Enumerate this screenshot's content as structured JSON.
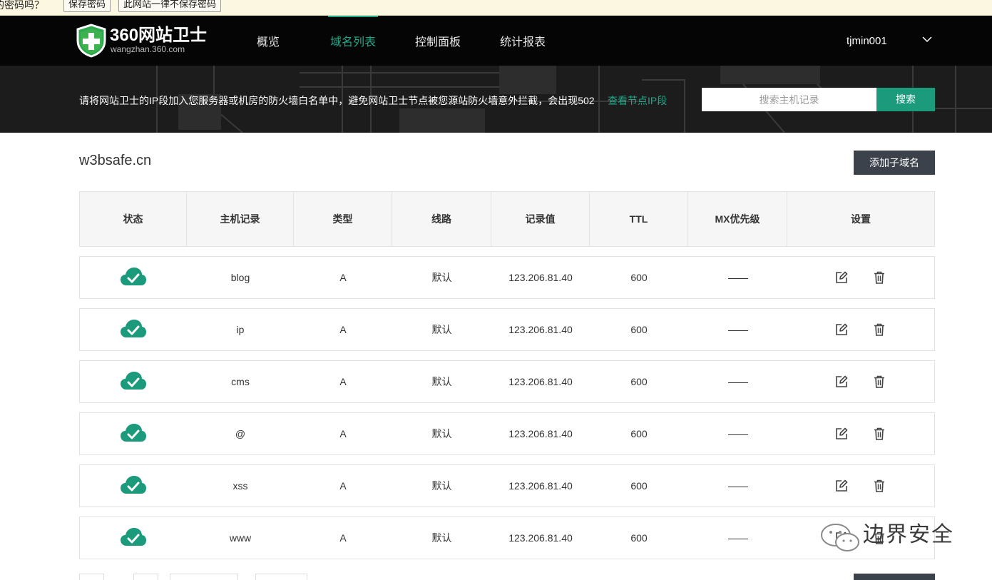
{
  "password_bar": {
    "question": "的密码吗？",
    "save_label": "保存密码",
    "never_label": "此网站一律不保存密码"
  },
  "nav": {
    "brand": "360网站卫士",
    "brand_sub": "wangzhan.360.com",
    "items": [
      {
        "label": "概览"
      },
      {
        "label": "域名列表",
        "active": true
      },
      {
        "label": "控制面板"
      },
      {
        "label": "统计报表"
      }
    ],
    "user": "tjmin001",
    "accent": "#1fa789"
  },
  "banner": {
    "notice": "请将网站卫士的IP段加入您服务器或机房的防火墙白名单中，避免网站卫士节点被您源站防火墙意外拦截，会出现502",
    "link": "查看节点IP段",
    "search_placeholder": "搜索主机记录",
    "search_button": "搜索"
  },
  "main": {
    "domain": "w3bsafe.cn",
    "add_button": "添加子域名",
    "columns": [
      "状态",
      "主机记录",
      "类型",
      "线路",
      "记录值",
      "TTL",
      "MX优先级",
      "设置"
    ],
    "rows": [
      {
        "host": "blog",
        "type": "A",
        "line": "默认",
        "value": "123.206.81.40",
        "ttl": "600",
        "mx": "",
        "status": "cloud-check"
      },
      {
        "host": "ip",
        "type": "A",
        "line": "默认",
        "value": "123.206.81.40",
        "ttl": "600",
        "mx": "",
        "status": "cloud-check"
      },
      {
        "host": "cms",
        "type": "A",
        "line": "默认",
        "value": "123.206.81.40",
        "ttl": "600",
        "mx": "",
        "status": "cloud-check"
      },
      {
        "host": "@",
        "type": "A",
        "line": "默认",
        "value": "123.206.81.40",
        "ttl": "600",
        "mx": "",
        "status": "cloud-check"
      },
      {
        "host": "xss",
        "type": "A",
        "line": "默认",
        "value": "123.206.81.40",
        "ttl": "600",
        "mx": "",
        "status": "cloud-check"
      },
      {
        "host": "www",
        "type": "A",
        "line": "默认",
        "value": "123.206.81.40",
        "ttl": "600",
        "mx": "",
        "status": "cloud-check"
      }
    ],
    "status_color": "#1b9a7c"
  },
  "watermark": {
    "text": "边界安全",
    "icon": "wechat-icon"
  }
}
